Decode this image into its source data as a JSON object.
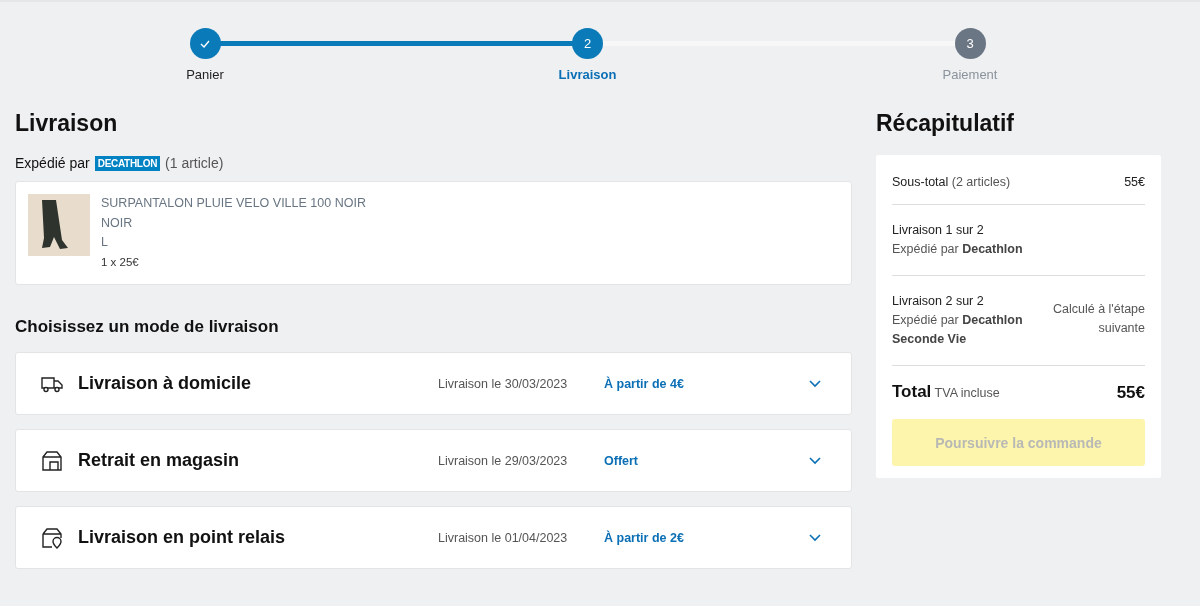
{
  "stepper": [
    {
      "label": "Panier",
      "done": true,
      "selected": false
    },
    {
      "label": "Livraison",
      "number": "2",
      "done": false,
      "selected": true
    },
    {
      "label": "Paiement",
      "number": "3",
      "done": false,
      "selected": false
    }
  ],
  "delivery": {
    "title": "Livraison",
    "shipped_by": "Expédié par",
    "seller_logo": "DECATHLON",
    "count": "(1 article)",
    "product": {
      "name": "SURPANTALON PLUIE VELO VILLE 100 NOIR",
      "variant": "NOIR",
      "size": "L",
      "price": "1 x 25€"
    },
    "options_title": "Choisissez un mode de livraison",
    "options": [
      {
        "kind": "home",
        "name": "Livraison à domicile",
        "date": "Livraison le 30/03/2023",
        "price": "À partir de 4€"
      },
      {
        "kind": "store",
        "name": "Retrait en magasin",
        "date": "Livraison le 29/03/2023",
        "price": "Offert"
      },
      {
        "kind": "relay",
        "name": "Livraison en point relais",
        "date": "Livraison le 01/04/2023",
        "price": "À partir de 2€"
      }
    ]
  },
  "summary": {
    "title": "Récapitulatif",
    "subtotal": {
      "label": "Sous-total",
      "count": "(2 articles)",
      "value": "55€"
    },
    "shipments": [
      {
        "title": "Livraison 1 sur 2",
        "seller": "Expédié par **Decathlon**"
      },
      {
        "title": "Livraison 2 sur 2",
        "seller": "Expédié par **Decathlon Seconde Vie**",
        "note": "Calculé à l'étape suivante"
      }
    ],
    "total": {
      "label": "Total",
      "tax": "TVA incluse",
      "value": "55€"
    },
    "button": {
      "label": "Poursuivre la commande",
      "disabled": true
    }
  }
}
